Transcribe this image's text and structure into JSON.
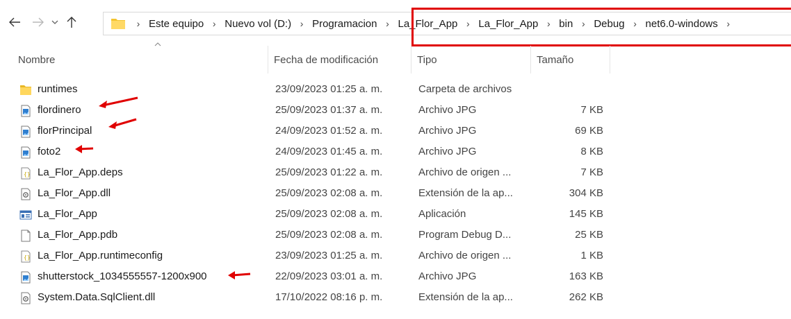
{
  "address_bar": {
    "crumbs": [
      "Este equipo",
      "Nuevo vol (D:)",
      "Programacion",
      "La_Flor_App",
      "La_Flor_App",
      "bin",
      "Debug",
      "net6.0-windows"
    ]
  },
  "columns": {
    "name": "Nombre",
    "date": "Fecha de modificación",
    "type": "Tipo",
    "size": "Tamaño"
  },
  "files": [
    {
      "name": "runtimes",
      "date": "23/09/2023 01:25 a. m.",
      "type": "Carpeta de archivos",
      "size": "",
      "icon": "folder-icon"
    },
    {
      "name": "flordinero",
      "date": "25/09/2023 01:37 a. m.",
      "type": "Archivo JPG",
      "size": "7 KB",
      "icon": "jpg-file-icon"
    },
    {
      "name": "florPrincipal",
      "date": "24/09/2023 01:52 a. m.",
      "type": "Archivo JPG",
      "size": "69 KB",
      "icon": "jpg-file-icon"
    },
    {
      "name": "foto2",
      "date": "24/09/2023 01:45 a. m.",
      "type": "Archivo JPG",
      "size": "8 KB",
      "icon": "jpg-file-icon"
    },
    {
      "name": "La_Flor_App.deps",
      "date": "25/09/2023 01:22 a. m.",
      "type": "Archivo de origen ...",
      "size": "7 KB",
      "icon": "json-file-icon"
    },
    {
      "name": "La_Flor_App.dll",
      "date": "25/09/2023 02:08 a. m.",
      "type": "Extensión de la ap...",
      "size": "304 KB",
      "icon": "dll-file-icon"
    },
    {
      "name": "La_Flor_App",
      "date": "25/09/2023 02:08 a. m.",
      "type": "Aplicación",
      "size": "145 KB",
      "icon": "exe-file-icon"
    },
    {
      "name": "La_Flor_App.pdb",
      "date": "25/09/2023 02:08 a. m.",
      "type": "Program Debug D...",
      "size": "25 KB",
      "icon": "blank-file-icon"
    },
    {
      "name": "La_Flor_App.runtimeconfig",
      "date": "23/09/2023 01:25 a. m.",
      "type": "Archivo de origen ...",
      "size": "1 KB",
      "icon": "json-file-icon"
    },
    {
      "name": "shutterstock_1034555557-1200x900",
      "date": "22/09/2023 03:01 a. m.",
      "type": "Archivo JPG",
      "size": "163 KB",
      "icon": "jpg-file-icon"
    },
    {
      "name": "System.Data.SqlClient.dll",
      "date": "17/10/2022 08:16 p. m.",
      "type": "Extensión de la ap...",
      "size": "262 KB",
      "icon": "dll-file-icon"
    }
  ],
  "annotations": {
    "highlight_color": "#e00000",
    "arrows_on_rows": [
      1,
      2,
      3,
      9
    ]
  }
}
